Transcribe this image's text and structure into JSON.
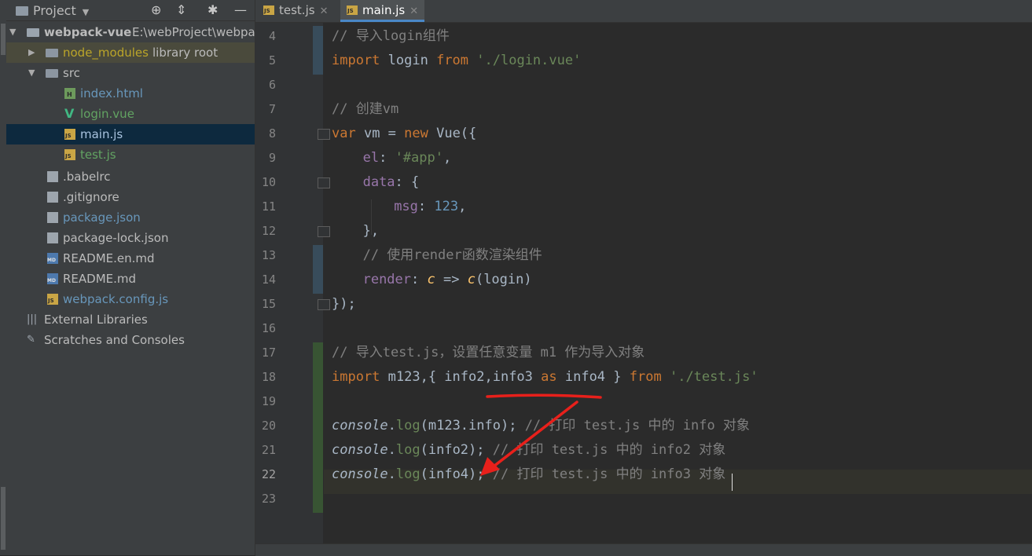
{
  "project_panel": {
    "title": "Project",
    "root": {
      "name": "webpack-vue",
      "path": "E:\\webProject\\webpa"
    },
    "node_modules": {
      "name": "node_modules",
      "tag": "library root"
    },
    "src": "src",
    "files": {
      "index_html": "index.html",
      "login_vue": "login.vue",
      "main_js": "main.js",
      "test_js": "test.js",
      "babelrc": ".babelrc",
      "gitignore": ".gitignore",
      "package_json": "package.json",
      "package_lock": "package-lock.json",
      "readme_en": "README.en.md",
      "readme": "README.md",
      "webpack_config": "webpack.config.js"
    },
    "external_libraries": "External Libraries",
    "scratches": "Scratches and Consoles"
  },
  "tabs": [
    {
      "label": "test.js",
      "active": false
    },
    {
      "label": "main.js",
      "active": true
    }
  ],
  "editor": {
    "current_line": 22,
    "lines": [
      {
        "n": "4",
        "tokens": {
          "a": "// 导入login组件"
        }
      },
      {
        "n": "5",
        "tokens": {
          "kw1": "import",
          "t1": " login ",
          "kw2": "from",
          "t2": " ",
          "s1": "'./login.vue'"
        }
      },
      {
        "n": "6",
        "tokens": {}
      },
      {
        "n": "7",
        "tokens": {
          "a": "// 创建vm"
        }
      },
      {
        "n": "8",
        "tokens": {
          "kw1": "var",
          "t1": " vm = ",
          "kw2": "new",
          "t2": " Vue({"
        }
      },
      {
        "n": "9",
        "tokens": {
          "f1": "el",
          "p1": ": ",
          "s1": "'#app'",
          "p2": ","
        }
      },
      {
        "n": "10",
        "tokens": {
          "f1": "data",
          "p1": ": {"
        }
      },
      {
        "n": "11",
        "tokens": {
          "f1": "msg",
          "p1": ": ",
          "n1": "123",
          "p2": ","
        }
      },
      {
        "n": "12",
        "tokens": {
          "p1": "},"
        }
      },
      {
        "n": "13",
        "tokens": {
          "a": "// 使用render函数渲染组件"
        }
      },
      {
        "n": "14",
        "tokens": {
          "f1": "render",
          "p1": ": ",
          "i1": "c",
          "p2": " => ",
          "i2": "c",
          "p3": "(login)"
        }
      },
      {
        "n": "15",
        "tokens": {
          "p1": "});"
        }
      },
      {
        "n": "16",
        "tokens": {}
      },
      {
        "n": "17",
        "tokens": {
          "a": "// 导入test.js，设置任意变量 m1 作为导入对象"
        }
      },
      {
        "n": "18",
        "tokens": {
          "kw1": "import",
          "t1": " m123,{ info2,",
          "t2": "info3 ",
          "kw2": "as",
          "t3": " info4",
          "t4": " } ",
          "kw3": "from",
          "t5": " ",
          "s1": "'./test.js'"
        }
      },
      {
        "n": "19",
        "tokens": {}
      },
      {
        "n": "20",
        "tokens": {
          "o1": "console",
          "p1": ".",
          "m1": "log",
          "p2": "(m123.info); ",
          "c1": "// 打印 test.js 中的 info 对象"
        }
      },
      {
        "n": "21",
        "tokens": {
          "o1": "console",
          "p1": ".",
          "m1": "log",
          "p2": "(info2); ",
          "c1": "// 打印 test.js 中的 info2 对象"
        }
      },
      {
        "n": "22",
        "tokens": {
          "o1": "console",
          "p1": ".",
          "m1": "log",
          "p2": "(info4); ",
          "c1": "// 打印 test.js 中的 info3 对象"
        }
      },
      {
        "n": "23",
        "tokens": {}
      }
    ]
  },
  "colors": {
    "keyword": "#cc7832",
    "string": "#6a8759",
    "number": "#6897bb",
    "comment": "#808080",
    "field": "#9876aa",
    "annotation": "#e8201b",
    "selection_row": "#0d293e"
  }
}
